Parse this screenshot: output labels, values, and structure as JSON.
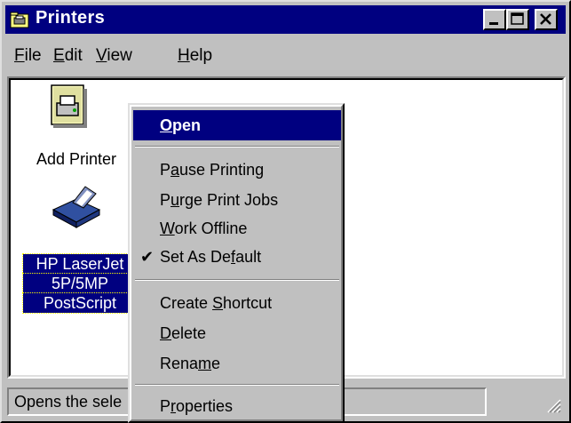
{
  "window": {
    "title": "Printers",
    "title_icon": "printers-folder-icon",
    "controls": [
      "minimize-icon",
      "maximize-icon",
      "close-icon"
    ]
  },
  "menubar": {
    "items": [
      {
        "pre": "",
        "ul": "F",
        "post": "ile"
      },
      {
        "pre": "",
        "ul": "E",
        "post": "dit"
      },
      {
        "pre": "",
        "ul": "V",
        "post": "iew"
      },
      {
        "pre": "",
        "ul": "H",
        "post": "elp"
      }
    ]
  },
  "icons": [
    {
      "label": "Add Printer",
      "icon": "add-printer-icon"
    },
    {
      "label_lines": [
        "HP LaserJet",
        "5P/5MP",
        "PostScript"
      ],
      "icon": "laser-printer-icon"
    }
  ],
  "context_menu": {
    "items": [
      {
        "pre": "",
        "ul": "O",
        "post": "pen"
      },
      {
        "pre": "P",
        "ul": "a",
        "post": "use Printing"
      },
      {
        "pre": "P",
        "ul": "u",
        "post": "rge Print Jobs"
      },
      {
        "pre": "",
        "ul": "W",
        "post": "ork Offline"
      },
      {
        "pre": "Set As De",
        "ul": "f",
        "post": "ault",
        "checked": true
      },
      {
        "pre": "Create ",
        "ul": "S",
        "post": "hortcut"
      },
      {
        "pre": "",
        "ul": "D",
        "post": "elete"
      },
      {
        "pre": "Rena",
        "ul": "m",
        "post": "e"
      },
      {
        "pre": "P",
        "ul": "r",
        "post": "operties"
      }
    ],
    "check_mark": "✔"
  },
  "statusbar": {
    "text": "Opens the sele"
  },
  "colors": {
    "titlebar": "#000080",
    "selection": "#000080",
    "face": "#c0c0c0"
  }
}
